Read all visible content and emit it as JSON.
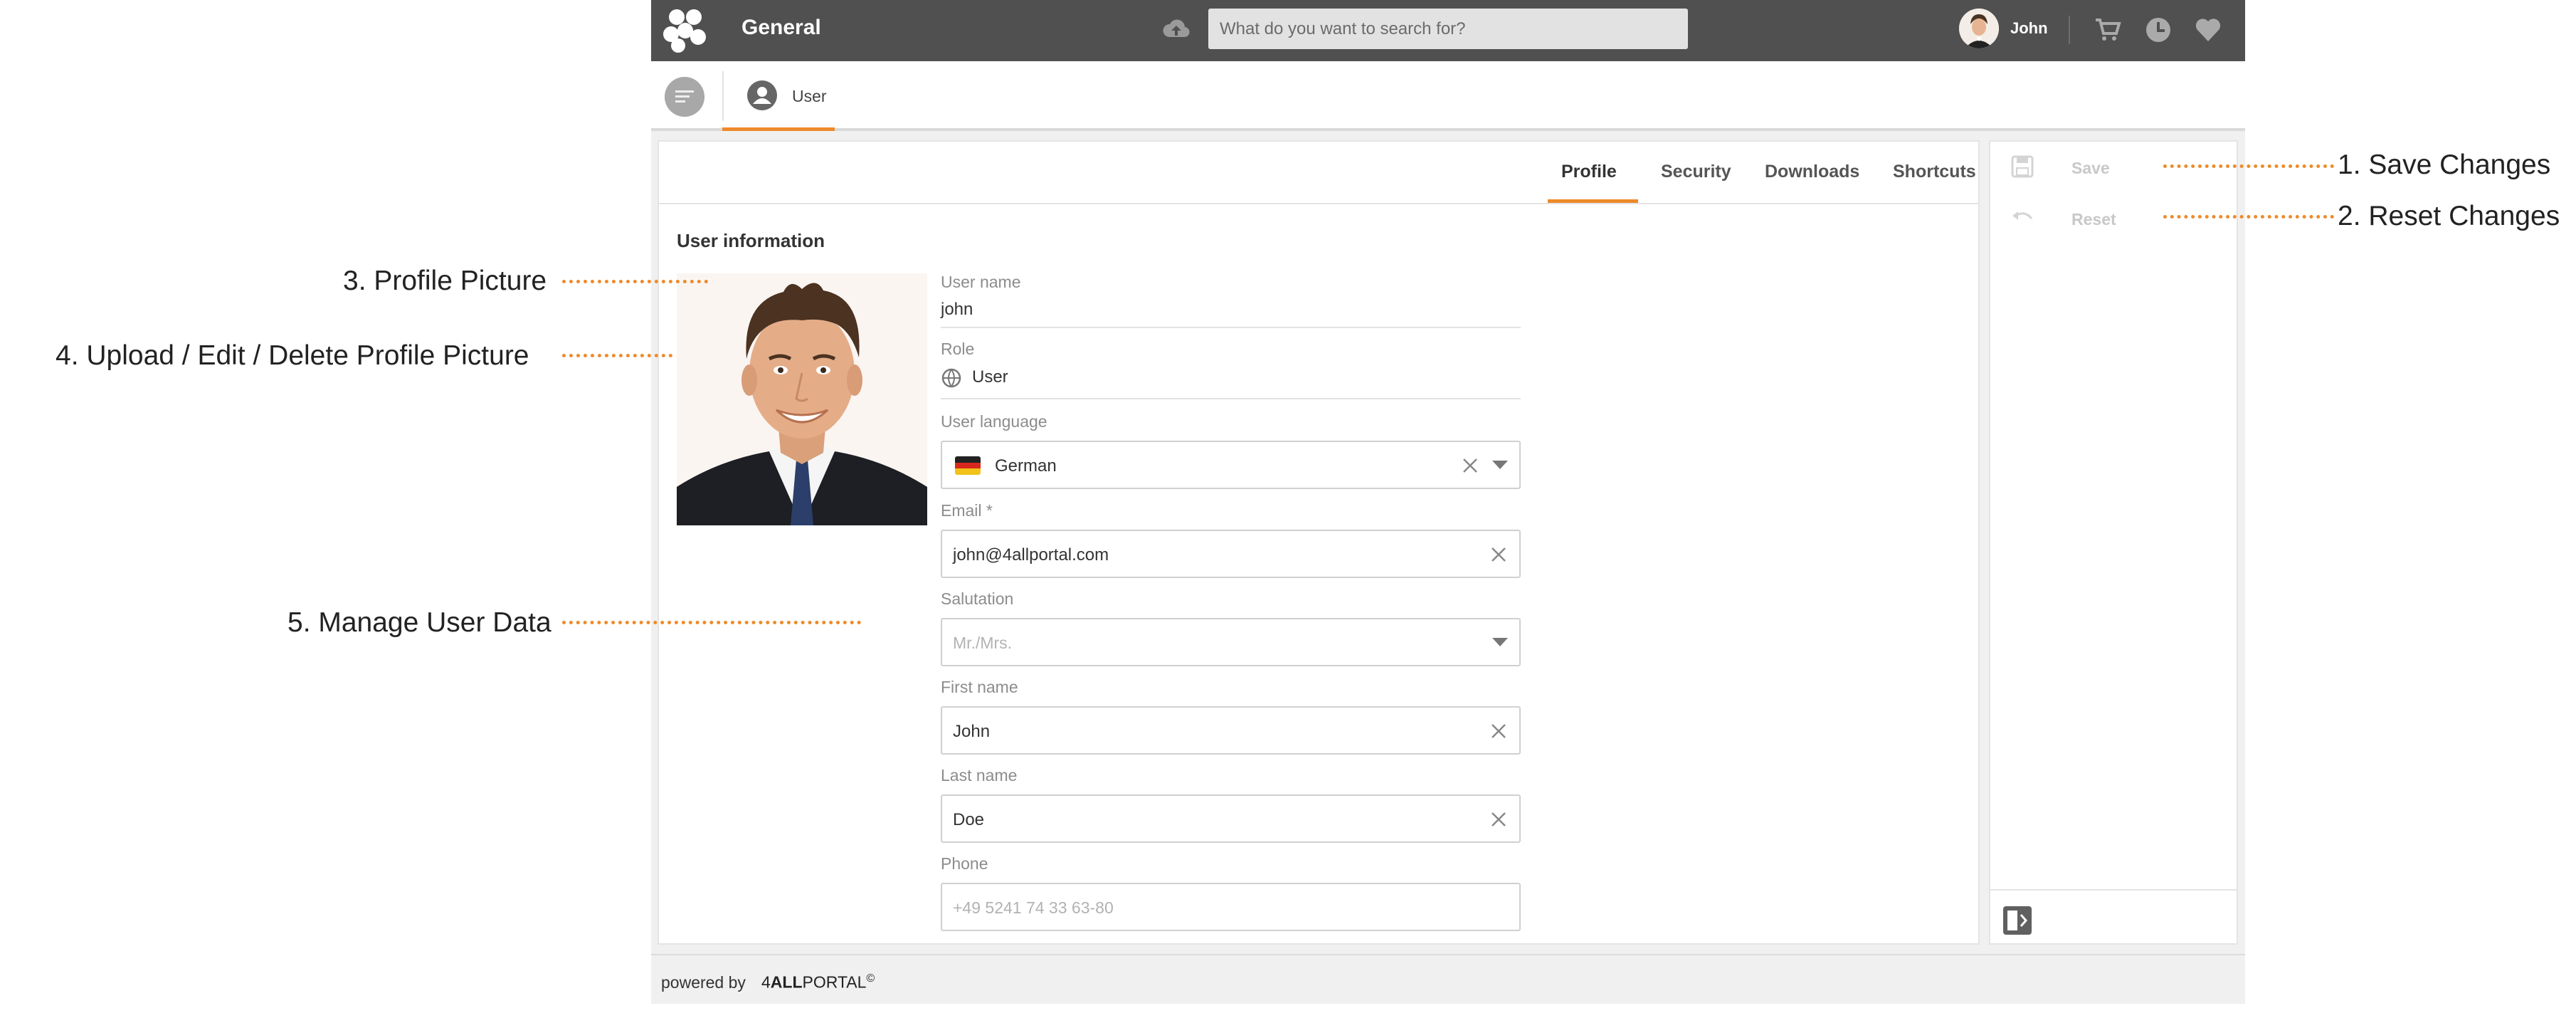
{
  "topbar": {
    "app_title": "General",
    "search_placeholder": "What do you want to search for?",
    "user_name": "John"
  },
  "subbar": {
    "tab_label": "User"
  },
  "tabs": [
    "Profile",
    "Security",
    "Downloads",
    "Shortcuts"
  ],
  "active_tab": "Profile",
  "section_title": "User information",
  "fields": {
    "username": {
      "label": "User name",
      "value": "john"
    },
    "role": {
      "label": "Role",
      "value": "User"
    },
    "language": {
      "label": "User language",
      "value": "German"
    },
    "email": {
      "label": "Email *",
      "value": "john@4allportal.com"
    },
    "salutation": {
      "label": "Salutation",
      "placeholder": "Mr./Mrs."
    },
    "first_name": {
      "label": "First name",
      "value": "John"
    },
    "last_name": {
      "label": "Last name",
      "value": "Doe"
    },
    "phone": {
      "label": "Phone",
      "placeholder": "+49 5241 74 33 63-80"
    }
  },
  "side_actions": {
    "save": "Save",
    "reset": "Reset"
  },
  "footer": {
    "powered_by": "powered by",
    "brand_prefix": "4",
    "brand_bold": "ALL",
    "brand_suffix": "PORTAL",
    "brand_mark": "©"
  },
  "annotations": {
    "save_changes": "1. Save Changes",
    "reset_changes": "2. Reset Changes",
    "profile_picture": "3. Profile Picture",
    "upload_picture": "4. Upload / Edit / Delete Profile Picture",
    "manage_user_data": "5. Manage User Data"
  },
  "colors": {
    "accent": "#ee8a2a",
    "topbar": "#505050",
    "disabled_text": "#c8c8c8"
  },
  "icons": [
    "logo-icon",
    "upload-cloud-icon",
    "cart-icon",
    "history-icon",
    "heart-icon",
    "menu-icon",
    "user-circle-icon",
    "globe-icon",
    "german-flag-icon",
    "close-icon",
    "chevron-down-icon",
    "save-icon",
    "undo-icon",
    "collapse-panel-icon"
  ]
}
